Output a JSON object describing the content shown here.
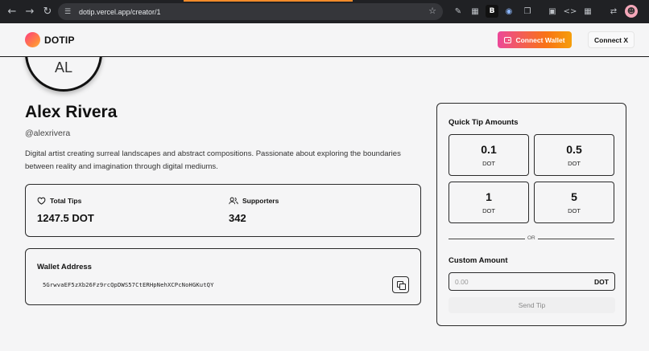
{
  "browser": {
    "url": "dotip.vercel.app/creator/1",
    "back_icon": "arrow-left",
    "forward_icon": "arrow-right",
    "reload_icon": "reload",
    "star_icon": "star",
    "tab_accent_color": "#f28b2a"
  },
  "header": {
    "logo_text": "DOTIP",
    "connect_wallet_label": "Connect Wallet",
    "connect_x_label": "Connect X",
    "brand_gradient": [
      "#ec4899",
      "#f97316",
      "#f59e0b"
    ]
  },
  "profile": {
    "avatar_initials": "AL",
    "name": "Alex Rivera",
    "handle": "@alexrivera",
    "bio": "Digital artist creating surreal landscapes and abstract compositions. Passionate about exploring the boundaries between reality and imagination through digital mediums."
  },
  "stats": {
    "total_tips_label": "Total Tips",
    "total_tips_value": "1247.5 DOT",
    "supporters_label": "Supporters",
    "supporters_value": "342"
  },
  "wallet": {
    "title": "Wallet Address",
    "address": "5GrwvaEF5zXb26Fz9rcQpDWS57CtERHpNehXCPcNoHGKutQY"
  },
  "tip_panel": {
    "title": "Quick Tip Amounts",
    "amounts": [
      {
        "value": "0.1",
        "unit": "DOT"
      },
      {
        "value": "0.5",
        "unit": "DOT"
      },
      {
        "value": "1",
        "unit": "DOT"
      },
      {
        "value": "5",
        "unit": "DOT"
      }
    ],
    "or_text": "OR",
    "custom_title": "Custom Amount",
    "custom_placeholder": "0.00",
    "custom_unit": "DOT",
    "send_label": "Send Tip"
  }
}
